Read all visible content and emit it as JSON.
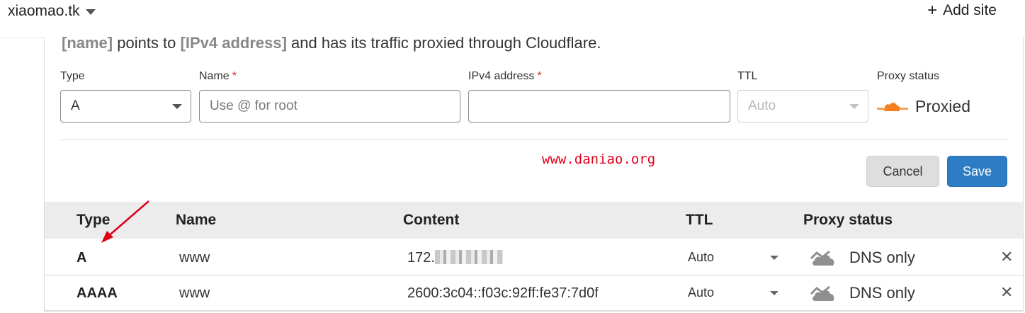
{
  "topbar": {
    "site_name": "xiaomao.tk",
    "add_site_label": "Add site"
  },
  "form": {
    "hint": {
      "name_placeholder": "[name]",
      "text1": " points to ",
      "ipv4_placeholder": "[IPv4 address]",
      "text2": " and has its traffic proxied through Cloudflare."
    },
    "labels": {
      "type": "Type",
      "name": "Name",
      "ipv4": "IPv4 address",
      "ttl": "TTL",
      "proxy_status": "Proxy status",
      "required_mark": "*"
    },
    "type_value": "A",
    "name_placeholder": "Use @ for root",
    "ipv4_value": "",
    "ttl_value": "Auto",
    "proxy_value": "Proxied",
    "cancel_label": "Cancel",
    "save_label": "Save"
  },
  "watermark": "www.daniao.org",
  "table": {
    "headers": [
      "Type",
      "Name",
      "Content",
      "TTL",
      "Proxy status"
    ],
    "rows": [
      {
        "type": "A",
        "name": "www",
        "content_prefix": "172.",
        "content": "172.",
        "ttl": "Auto",
        "proxy": "DNS only"
      },
      {
        "type": "AAAA",
        "name": "www",
        "content": "2600:3c04::f03c:92ff:fe37:7d0f",
        "ttl": "Auto",
        "proxy": "DNS only"
      }
    ]
  },
  "colors": {
    "save_button": "#2e7cc4",
    "proxied_orange": "#f38020",
    "dns_only_gray": "#8f8f8f",
    "annotation_red": "#e0001a",
    "watermark_red": "#e0001a"
  },
  "icons": {
    "caret": "chevron-down-icon",
    "add": "plus-icon",
    "proxied": "orange-cloud-icon",
    "dns_only": "gray-cloud-icon",
    "delete": "close-icon"
  }
}
